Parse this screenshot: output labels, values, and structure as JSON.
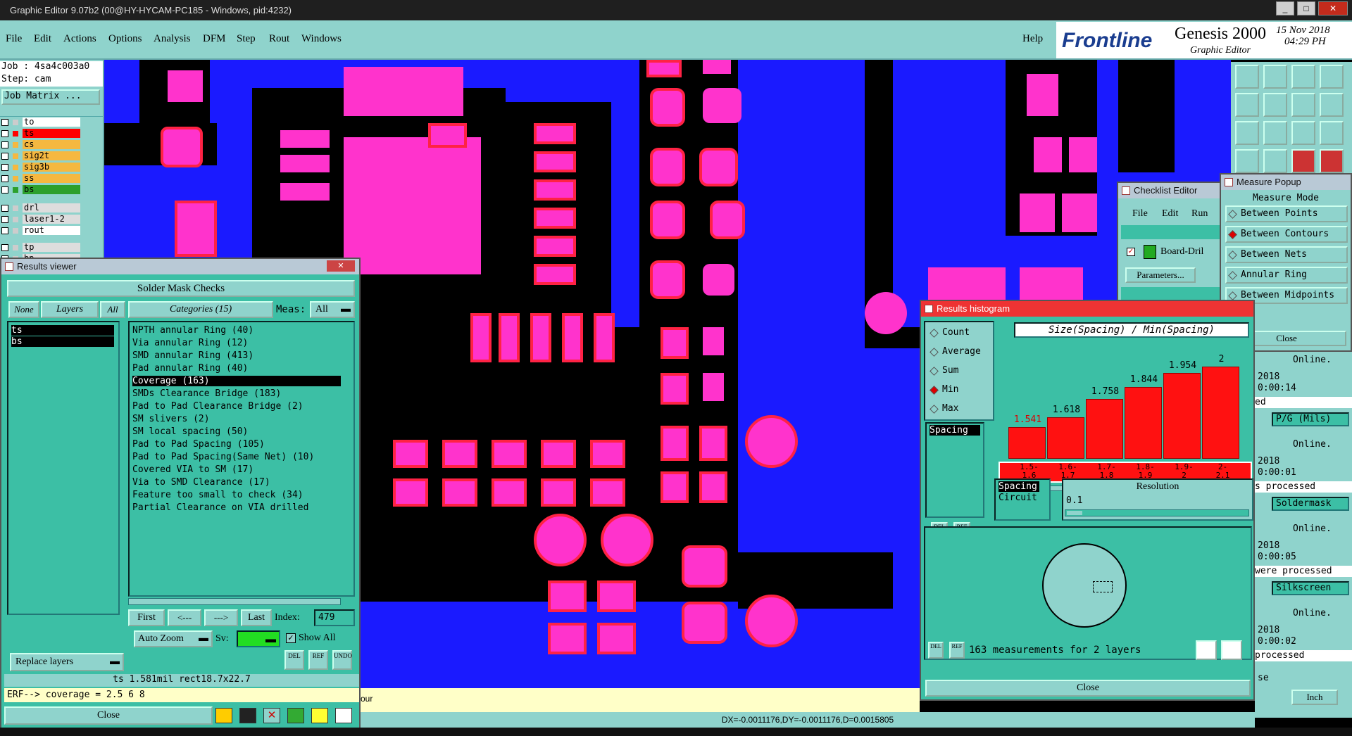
{
  "window": {
    "title": "Graphic Editor 9.07b2 (00@HY-HYCAM-PC185 - Windows, pid:4232)"
  },
  "menu": [
    "File",
    "Edit",
    "Actions",
    "Options",
    "Analysis",
    "DFM",
    "Step",
    "Rout",
    "Windows"
  ],
  "help_label": "Help",
  "brand": {
    "logo": "Frontline",
    "product": "Genesis 2000",
    "subtitle": "Graphic Editor",
    "date": "15 Nov 2018",
    "time": "04:29 PH"
  },
  "left_panel": {
    "job": "Job : 4sa4c003a0",
    "step": "Step: cam",
    "job_matrix": "Job Matrix ...",
    "layers": [
      {
        "name": "to",
        "color": "#ffffff"
      },
      {
        "name": "ts",
        "color": "#ff0000"
      },
      {
        "name": "cs",
        "color": "#f5b840"
      },
      {
        "name": "sig2t",
        "color": "#f5b840"
      },
      {
        "name": "sig3b",
        "color": "#f5b840"
      },
      {
        "name": "ss",
        "color": "#f5b840"
      },
      {
        "name": "bs",
        "color": "#2ca02c"
      },
      {
        "name": "drl",
        "color": "#dddddd"
      },
      {
        "name": "laser1-2",
        "color": "#dddddd"
      },
      {
        "name": "rout",
        "color": "#ffffff"
      },
      {
        "name": "tp",
        "color": "#dddddd"
      },
      {
        "name": "bp",
        "color": "#dddddd"
      }
    ]
  },
  "results_viewer": {
    "title": "Results viewer",
    "header": "Solder Mask Checks",
    "none_label": "None",
    "layers_label": "Layers",
    "all_label": "All",
    "categories_label": "Categories (15)",
    "meas_label": "Meas:",
    "meas_value": "All",
    "layers": [
      "ts",
      "bs"
    ],
    "categories": [
      "NPTH annular Ring (40)",
      "Via annular Ring (12)",
      "SMD annular Ring (413)",
      "Pad annular Ring (40)",
      "Coverage (163)",
      "SMDs Clearance Bridge (183)",
      "Pad to Pad Clearance Bridge (2)",
      "SM slivers (2)",
      "SM local spacing (50)",
      "Pad to Pad Spacing (105)",
      "Pad to Pad Spacing(Same Net) (10)",
      "Covered VIA to SM (17)",
      "Via to SMD Clearance (17)",
      "Feature too small to check (34)",
      "Partial Clearance on VIA drilled"
    ],
    "selected_category": 4,
    "nav": {
      "first": "First",
      "prev": "<---",
      "next": "--->",
      "last": "Last",
      "index_label": "Index:",
      "index_value": "479"
    },
    "auto_zoom": "Auto Zoom",
    "sv_label": "Sv:",
    "show_all": "Show All",
    "replace_layers": "Replace layers",
    "del": "DEL",
    "ref": "REF",
    "undo": "UNDO",
    "status1": "ts 1.581mil  rect18.7x22.7",
    "status2": "ERF--> coverage = 2.5 6 8",
    "close": "Close"
  },
  "checklist_editor": {
    "title": "Checklist Editor",
    "menu": [
      "File",
      "Edit",
      "Run"
    ],
    "item": "Board-Dril",
    "parameters": "Parameters..."
  },
  "measure_popup": {
    "title": "Measure Popup",
    "mode_label": "Measure Mode",
    "modes": [
      "Between Points",
      "Between Contours",
      "Between Nets",
      "Annular Ring",
      "Between Midpoints"
    ],
    "selected": 1,
    "close": "Close"
  },
  "histogram": {
    "title": "Results histogram",
    "options": [
      "Count",
      "Average",
      "Sum",
      "Min",
      "Max"
    ],
    "selected_option": 3,
    "list_item": "Spacing",
    "chart_title": "Size(Spacing) / Min(Spacing)",
    "bars": [
      {
        "label": "1.541",
        "min": "1.5-",
        "max": "1.6",
        "value": 1.541
      },
      {
        "label": "1.618",
        "min": "1.6-",
        "max": "1.7",
        "value": 1.618
      },
      {
        "label": "1.758",
        "min": "1.7-",
        "max": "1.8",
        "value": 1.758
      },
      {
        "label": "1.844",
        "min": "1.8-",
        "max": "1.9",
        "value": 1.844
      },
      {
        "label": "1.954",
        "min": "1.9-",
        "max": "2",
        "value": 1.954
      },
      {
        "label": "2",
        "min": "2-",
        "max": "2.1",
        "value": 2
      }
    ],
    "resolution_label": "Resolution",
    "resolution_value": "0.1",
    "list2": [
      "Spacing",
      "Circuit"
    ],
    "del": "DEL",
    "ref": "REF",
    "summary": "163 measurements for 2 layers",
    "close": "Close"
  },
  "right_strip": {
    "entries": [
      {
        "online": "Online.",
        "date": "2018",
        "time": "0:00:14",
        "text": "ed",
        "field": "P/G (Mils)"
      },
      {
        "online": "Online.",
        "date": "2018",
        "time": "0:00:01",
        "text": "s processed",
        "field": "Soldermask"
      },
      {
        "online": "Online.",
        "date": "2018",
        "time": "0:00:05",
        "text": "were processed",
        "field": "Silkscreen"
      },
      {
        "online": "Online.",
        "date": "2018",
        "time": "0:00:02",
        "text": "processed",
        "field": ""
      }
    ],
    "se": "se",
    "inch": "Inch"
  },
  "coords": "DX=-0.0011176,DY=-0.0011176,D=0.0015805",
  "bottom_text": "our"
}
